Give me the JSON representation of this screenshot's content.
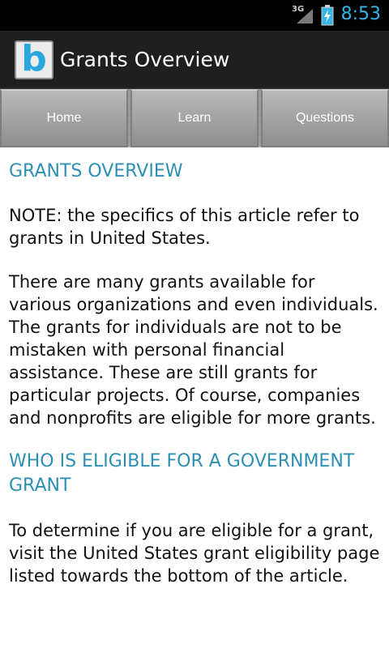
{
  "status_bar": {
    "network": "3G",
    "time": "8:53"
  },
  "action_bar": {
    "logo_letter": "b",
    "title": "Grants Overview"
  },
  "tabs": [
    {
      "label": "Home"
    },
    {
      "label": "Learn"
    },
    {
      "label": "Questions"
    }
  ],
  "article": {
    "heading1": "GRANTS OVERVIEW",
    "note": "NOTE: the specifics of this article refer to grants in United States.",
    "para1": "There are many grants available for various organizations and even individuals. The grants for individuals are not to be mistaken with personal financial assistance. These are still grants for particular projects. Of course, companies and nonprofits are eligible for more grants.",
    "heading2": "WHO IS ELIGIBLE FOR A GOVERNMENT GRANT",
    "para2": "To determine if you are eligible for a grant, visit the United States grant eligibility page listed towards the bottom of the article."
  },
  "colors": {
    "accent": "#33b5e5",
    "heading": "#2e8fb5",
    "logo": "#2aa7dc"
  }
}
